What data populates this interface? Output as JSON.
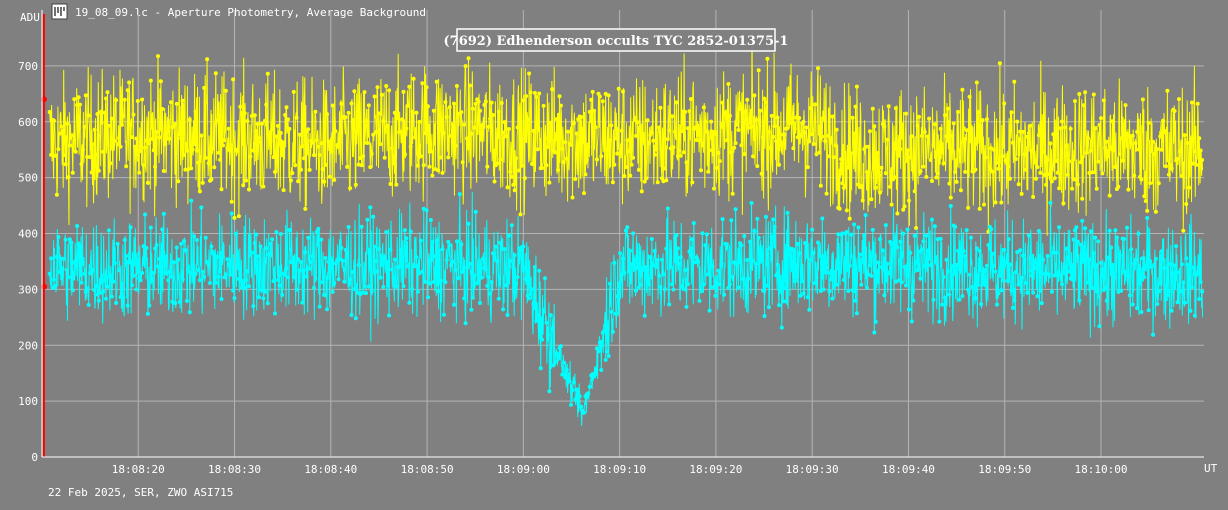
{
  "window": {
    "title": "19_08_09.lc - Aperture Photometry, Average Background",
    "icon": "lightcurve-app-icon"
  },
  "footer": {
    "text": "22 Feb 2025, SER, ZWO ASI715"
  },
  "colors": {
    "background": "#808080",
    "grid": "#b4b4b4",
    "target": "#ffff00",
    "comparison": "#00ffff",
    "marker": "#ff0000"
  },
  "chart_data": {
    "type": "line",
    "title": "(7692) Edhenderson occults TYC 2852-01375-1",
    "ylabel": "ADU",
    "xlabel": "UT",
    "ylim": [
      0,
      800
    ],
    "yticks": [
      "0",
      "100",
      "200",
      "300",
      "400",
      "500",
      "600",
      "700"
    ],
    "xlim": [
      "18:08:10.0",
      "18:10:10.7"
    ],
    "xticks": [
      "18:08:20",
      "18:08:30",
      "18:08:40",
      "18:08:50",
      "18:09:00",
      "18:09:10",
      "18:09:20",
      "18:09:30",
      "18:09:40",
      "18:09:50",
      "18:10:00"
    ],
    "grid": true,
    "series": [
      {
        "color": "#ffff00",
        "mean": 560,
        "low": 430,
        "high": 770,
        "x_every_seconds": 0.05,
        "points": [
          {
            "x": "18:08:10.8",
            "y": 560
          },
          {
            "x": "18:08:20.0",
            "y": 580
          },
          {
            "x": "18:08:30.0",
            "y": 570
          },
          {
            "x": "18:08:40.0",
            "y": 555
          },
          {
            "x": "18:08:50.0",
            "y": 590
          },
          {
            "x": "18:09:00.0",
            "y": 575
          },
          {
            "x": "18:09:10.0",
            "y": 565
          },
          {
            "x": "18:09:20.0",
            "y": 580
          },
          {
            "x": "18:09:30.0",
            "y": 590
          },
          {
            "x": "18:09:35.0",
            "y": 540
          },
          {
            "x": "18:09:40.0",
            "y": 550
          },
          {
            "x": "18:09:50.0",
            "y": 545
          },
          {
            "x": "18:10:00.0",
            "y": 555
          },
          {
            "x": "18:10:10.6",
            "y": 545
          }
        ]
      },
      {
        "color": "#00ffff",
        "mean": 340,
        "low": 200,
        "high": 470,
        "x_every_seconds": 0.05,
        "points": [
          {
            "x": "18:08:10.8",
            "y": 340
          },
          {
            "x": "18:08:20.0",
            "y": 335
          },
          {
            "x": "18:08:30.0",
            "y": 345
          },
          {
            "x": "18:08:40.0",
            "y": 340
          },
          {
            "x": "18:08:50.0",
            "y": 345
          },
          {
            "x": "18:09:00.0",
            "y": 335
          },
          {
            "x": "18:09:06.2",
            "y": 75
          },
          {
            "x": "18:09:10.0",
            "y": 340
          },
          {
            "x": "18:09:20.0",
            "y": 340
          },
          {
            "x": "18:09:30.0",
            "y": 350
          },
          {
            "x": "18:09:40.0",
            "y": 345
          },
          {
            "x": "18:09:50.0",
            "y": 335
          },
          {
            "x": "18:10:00.0",
            "y": 330
          },
          {
            "x": "18:10:10.6",
            "y": 330
          }
        ]
      }
    ],
    "marker": {
      "x": "18:08:10.2",
      "color": "#ff0000",
      "points_y": [
        640,
        305
      ]
    }
  }
}
